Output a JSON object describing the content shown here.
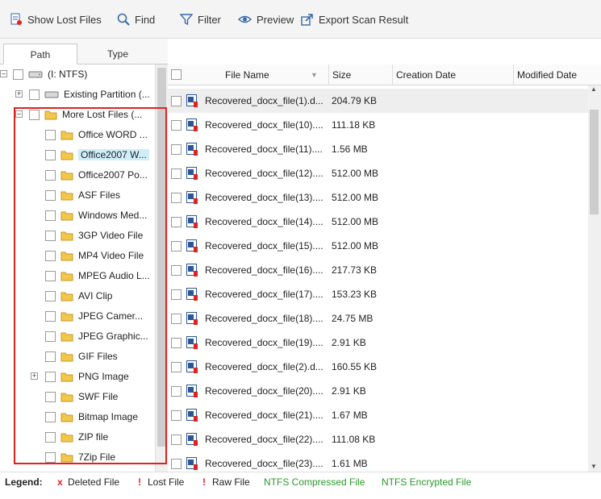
{
  "toolbar": {
    "show_lost_files": "Show Lost Files",
    "find": "Find",
    "filter": "Filter",
    "preview": "Preview",
    "export": "Export Scan Result"
  },
  "tabs": [
    "Path",
    "Type"
  ],
  "tree": {
    "root": "(I: NTFS)",
    "existing": "Existing Partition (...",
    "more_lost": "More Lost Files (...",
    "items": [
      "Office WORD ...",
      "Office2007 W...",
      "Office2007 Po...",
      "ASF Files",
      "Windows Med...",
      "3GP Video File",
      "MP4 Video File",
      "MPEG Audio L...",
      "AVI Clip",
      "JPEG Camer...",
      "JPEG Graphic...",
      "GIF Files",
      "PNG Image",
      "SWF File",
      "Bitmap Image",
      "ZIP file",
      "7Zip File"
    ]
  },
  "columns": {
    "name": "File Name",
    "size": "Size",
    "created": "Creation Date",
    "modified": "Modified Date"
  },
  "files": [
    {
      "name": "Recovered_docx_file(1).d...",
      "size": "204.79 KB"
    },
    {
      "name": "Recovered_docx_file(10)....",
      "size": "111.18 KB"
    },
    {
      "name": "Recovered_docx_file(11)....",
      "size": "1.56 MB"
    },
    {
      "name": "Recovered_docx_file(12)....",
      "size": "512.00 MB"
    },
    {
      "name": "Recovered_docx_file(13)....",
      "size": "512.00 MB"
    },
    {
      "name": "Recovered_docx_file(14)....",
      "size": "512.00 MB"
    },
    {
      "name": "Recovered_docx_file(15)....",
      "size": "512.00 MB"
    },
    {
      "name": "Recovered_docx_file(16)....",
      "size": "217.73 KB"
    },
    {
      "name": "Recovered_docx_file(17)....",
      "size": "153.23 KB"
    },
    {
      "name": "Recovered_docx_file(18)....",
      "size": "24.75 MB"
    },
    {
      "name": "Recovered_docx_file(19)....",
      "size": "2.91 KB"
    },
    {
      "name": "Recovered_docx_file(2).d...",
      "size": "160.55 KB"
    },
    {
      "name": "Recovered_docx_file(20)....",
      "size": "2.91 KB"
    },
    {
      "name": "Recovered_docx_file(21)....",
      "size": "1.67 MB"
    },
    {
      "name": "Recovered_docx_file(22)....",
      "size": "111.08 KB"
    },
    {
      "name": "Recovered_docx_file(23)....",
      "size": "1.61 MB"
    }
  ],
  "legend": {
    "label": "Legend:",
    "deleted_mark": "x",
    "deleted": "Deleted File",
    "lost_mark": "!",
    "lost": "Lost File",
    "raw_mark": "!",
    "raw": "Raw File",
    "compressed": "NTFS Compressed File",
    "encrypted": "NTFS Encrypted File"
  },
  "colors": {
    "highlight_box": "#e0221f",
    "selected_row": "#cfeefa",
    "ntfs_green": "#2a9a2a",
    "mark_red": "#e0221f"
  }
}
